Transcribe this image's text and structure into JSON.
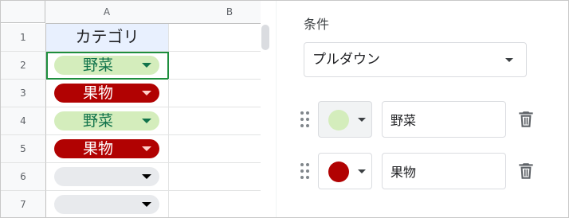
{
  "sheet": {
    "columns": [
      "A",
      "B"
    ],
    "row_numbers": [
      "1",
      "2",
      "3",
      "4",
      "5",
      "6",
      "7"
    ],
    "header_cell": "カテゴリ",
    "rows": [
      {
        "value": "野菜",
        "style": "veg"
      },
      {
        "value": "果物",
        "style": "fruit"
      },
      {
        "value": "野菜",
        "style": "veg"
      },
      {
        "value": "果物",
        "style": "fruit"
      },
      {
        "value": "",
        "style": "empty"
      },
      {
        "value": "",
        "style": "empty"
      }
    ]
  },
  "panel": {
    "condition_label": "条件",
    "condition_value": "プルダウン",
    "options": [
      {
        "text": "野菜",
        "color": "#d4edbc"
      },
      {
        "text": "果物",
        "color": "#b10202"
      }
    ]
  },
  "colors": {
    "veg_chip_bg": "#d4edbc",
    "veg_chip_text": "#11734b",
    "fruit_chip_bg": "#b10202",
    "fruit_chip_text": "#ffffff",
    "selection_border": "#1e8e3e",
    "header_cell_bg": "#e8f0fe"
  },
  "icons": [
    "dropdown-arrow-icon",
    "drag-handle-icon",
    "chevron-down-icon",
    "trash-icon"
  ]
}
